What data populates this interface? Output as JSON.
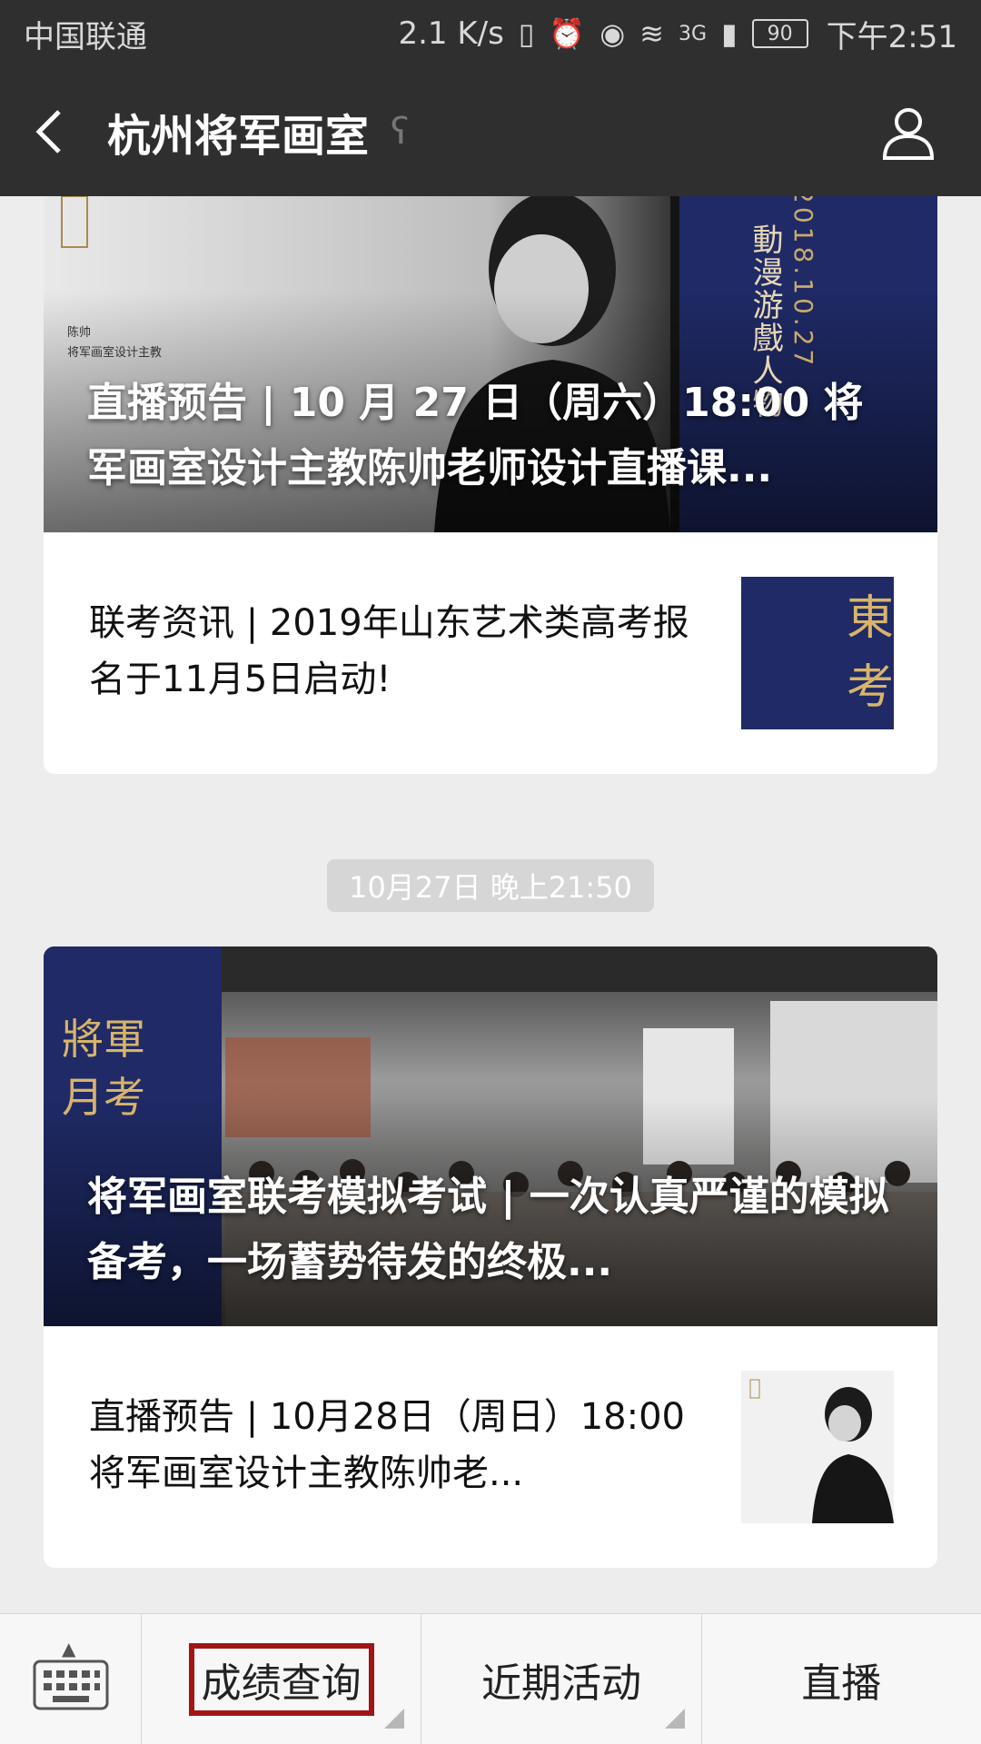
{
  "status_bar": {
    "carrier": "中国联通",
    "speed": "2.1 K/s",
    "signal": "3G",
    "battery": "90",
    "time": "下午2:51"
  },
  "header": {
    "title": "杭州将军画室"
  },
  "feed": {
    "card1": {
      "hero_title": "直播预告 | 10 月 27 日（周六）18:00 将军画室设计主教陈帅老师设计直播课...",
      "hero_overlay_name": "陈帅",
      "hero_overlay_role": "将军画室设计主教",
      "hero_vertical_text": "動漫游戲人物",
      "hero_date": "2018.10.27",
      "item_text": "联考资讯 | 2019年山东艺术类高考报名于11月5日启动!",
      "thumb_text": "山東考訊"
    },
    "timestamp": "10月27日 晚上21:50",
    "card2": {
      "hero_title": "将军画室联考模拟考试 | 一次认真严谨的模拟备考，一场蓄势待发的终极...",
      "hero_badge_line1": "將軍",
      "hero_badge_line2": "月考",
      "item_text": "直播预告 | 10月28日（周日）18:00将军画室设计主教陈帅老..."
    }
  },
  "menu": {
    "items": [
      {
        "label": "成绩查询"
      },
      {
        "label": "近期活动"
      },
      {
        "label": "直播"
      }
    ]
  },
  "colors": {
    "header_bg": "#2f2f2f",
    "page_bg": "#ededed",
    "highlight": "#a01616",
    "navy": "#1f2a66"
  }
}
